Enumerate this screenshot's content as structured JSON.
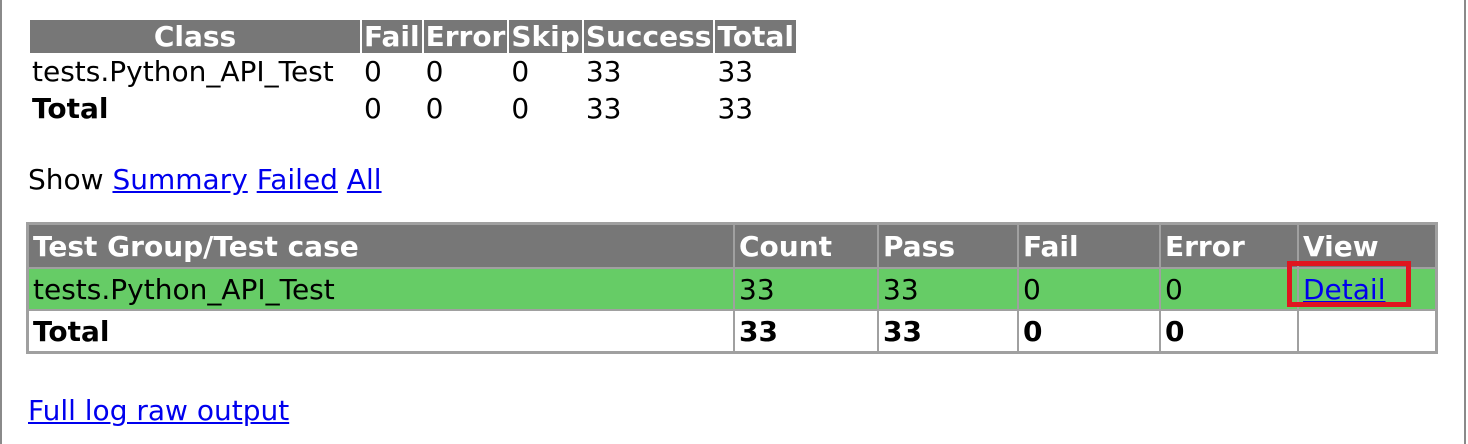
{
  "summary": {
    "headers": [
      "Class",
      "Fail",
      "Error",
      "Skip",
      "Success",
      "Total"
    ],
    "rows": [
      {
        "name": "tests.Python_API_Test",
        "fail": "0",
        "error": "0",
        "skip": "0",
        "success": "33",
        "total": "33"
      },
      {
        "name": "Total",
        "fail": "0",
        "error": "0",
        "skip": "0",
        "success": "33",
        "total": "33"
      }
    ]
  },
  "show": {
    "label": "Show",
    "links": [
      "Summary",
      "Failed",
      "All"
    ]
  },
  "detail": {
    "headers": [
      "Test Group/Test case",
      "Count",
      "Pass",
      "Fail",
      "Error",
      "View"
    ],
    "group_row": {
      "name": "tests.Python_API_Test",
      "count": "33",
      "pass": "33",
      "fail": "0",
      "error": "0",
      "view": "Detail"
    },
    "total_row": {
      "name": "Total",
      "count": "33",
      "pass": "33",
      "fail": "0",
      "error": "0"
    }
  },
  "footer": {
    "raw_log_link": "Full log raw output"
  },
  "colors": {
    "header_bg": "#777777",
    "pass_row_bg": "#66cc66",
    "link": "#0000ee",
    "highlight": "#e0151f"
  }
}
